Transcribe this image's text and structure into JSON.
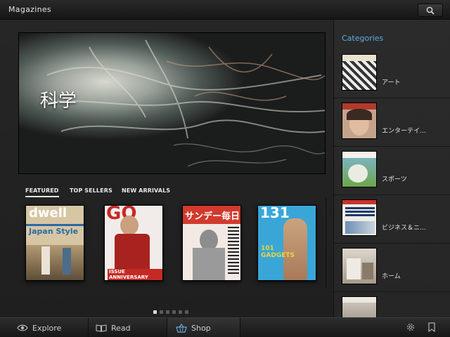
{
  "app": {
    "title": "Magazines"
  },
  "hero": {
    "label": "科学"
  },
  "tabs": [
    {
      "label": "FEATURED",
      "active": true
    },
    {
      "label": "TOP SELLERS",
      "active": false
    },
    {
      "label": "NEW ARRIVALS",
      "active": false
    }
  ],
  "covers": [
    {
      "masthead": "dwell",
      "headline": "Japan Style",
      "bg": "#d7c6a4",
      "accent": "#2b6aa6"
    },
    {
      "masthead": "GQ",
      "headline": "ISSUE ANNIVERSARY",
      "bg": "#f1ecea",
      "accent": "#c42a25"
    },
    {
      "masthead": "サンデー毎日",
      "headline": "",
      "bg": "#d23a2d",
      "accent": "#f2e9e5"
    },
    {
      "masthead": "131",
      "headline": "101 GADGETS",
      "bg": "#3aa6d8",
      "accent": "#e8d53b"
    }
  ],
  "pager": {
    "count": 6,
    "active_index": 0
  },
  "sidebar": {
    "title": "Categories",
    "items": [
      {
        "label": "アート",
        "thumb_color": "#9e9e9e"
      },
      {
        "label": "エンターテイ...",
        "thumb_color": "#b23a2e"
      },
      {
        "label": "スポーツ",
        "thumb_color": "#6ea54c"
      },
      {
        "label": "ビジネス＆ニ...",
        "thumb_color": "#d9d7d1"
      },
      {
        "label": "ホーム",
        "thumb_color": "#c9c2b4"
      },
      {
        "label": "",
        "thumb_color": "#b0a89c"
      }
    ]
  },
  "bottom": {
    "explore": "Explore",
    "read": "Read",
    "shop": "Shop",
    "settings_icon": "gear-icon",
    "bookmark_icon": "bookmark-icon"
  },
  "colors": {
    "accent": "#5eaee8"
  }
}
